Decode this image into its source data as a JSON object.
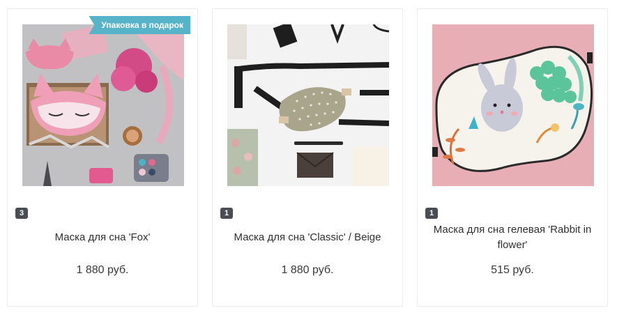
{
  "products": [
    {
      "badge": "Упаковка в подарок",
      "qty": "3",
      "name": "Маска для сна 'Fox'",
      "price": "1 880 руб."
    },
    {
      "qty": "1",
      "name": "Маска для сна 'Classic' / Beige",
      "price": "1 880 руб."
    },
    {
      "qty": "1",
      "name": "Маска для сна гелевая 'Rabbit in flower'",
      "price": "515 руб."
    }
  ],
  "colors": {
    "badge_bg": "#56b3c8",
    "qty_bg": "#4a4e54",
    "card_border": "#ececec"
  }
}
